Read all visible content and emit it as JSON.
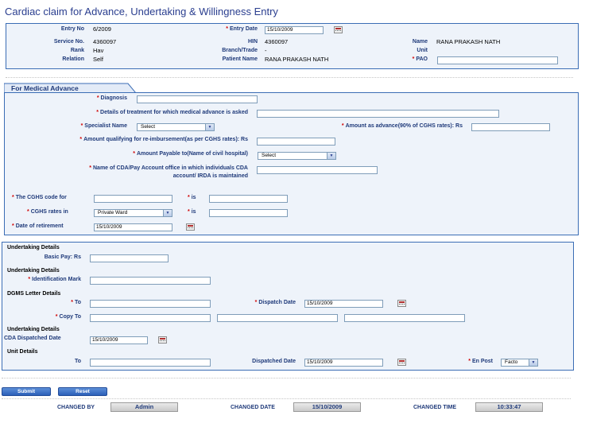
{
  "page": {
    "title": "Cardiac claim for Advance, Undertaking & Willingness Entry"
  },
  "header": {
    "entry_no_label": "Entry No",
    "entry_no": "6/2009",
    "entry_date_label": "Entry Date",
    "entry_date": "15/10/2009",
    "service_no_label": "Service No.",
    "service_no": "4360097",
    "hin_label": "HIN",
    "hin": "4360097",
    "name_label": "Name",
    "name": "RANA PRAKASH NATH",
    "rank_label": "Rank",
    "rank": "Hav",
    "branch_label": "Branch/Trade",
    "branch": "-",
    "unit_label": "Unit",
    "unit": "",
    "relation_label": "Relation",
    "relation": "Self",
    "patient_name_label": "Patient Name",
    "patient_name": "RANA PRAKASH NATH",
    "pao_label": "PAO",
    "pao": ""
  },
  "medical": {
    "section_title": "For Medical Advance",
    "diagnosis_label": "Diagnosis",
    "diagnosis": "",
    "details_label": "Details of treatment for which medical advance is asked",
    "details": "",
    "specialist_label": "Specialist Name",
    "specialist": "Select",
    "amount_advance_label": "Amount as advance(90% of CGHS rates): Rs",
    "amount_advance": "",
    "amount_reimb_label": "Amount qualifying for re-imbursement(as per CGHS rates): Rs",
    "amount_reimb": "",
    "payable_label": "Amount Payable to(Name of civil hospital)",
    "payable": "Select",
    "cda_label_1": "Name of CDA/Pay Account office in which individuals CDA",
    "cda_label_2": "account/ IRDA is maintained",
    "cda": "",
    "cghs_code_label": "The CGHS code for",
    "cghs_code": "",
    "is_label": "is",
    "cghs_code_is": "",
    "cghs_rates_label": "CGHS rates in",
    "cghs_rates": "Private Ward",
    "cghs_rates_is": "",
    "retirement_label": "Date of retirement",
    "retirement": "15/10/2009"
  },
  "undertaking": {
    "heading1": "Undertaking Details",
    "basic_pay_label": "Basic Pay: Rs",
    "basic_pay": "",
    "heading2": "Undertaking Details",
    "identification_label": "Identification Mark",
    "identification": "",
    "heading3": "DGMS Letter Details",
    "to_label": "To",
    "to": "",
    "dispatch_date_label": "Dispatch Date",
    "dispatch_date": "15/10/2009",
    "copy_to_label": "Copy To",
    "copy_to_1": "",
    "copy_to_2": "",
    "copy_to_3": "",
    "heading4": "Undertaking Details",
    "cda_dispatched_label": "CDA Dispatched Date",
    "cda_dispatched": "15/10/2009",
    "heading5": "Unit Details",
    "unit_to_label": "To",
    "unit_to": "",
    "dispatched_date_label": "Dispatched Date",
    "dispatched_date": "15/10/2009",
    "en_post_label": "En Post",
    "en_post": "Facto"
  },
  "actions": {
    "submit": "Submit",
    "reset": "Reset"
  },
  "footer": {
    "changed_by_label": "CHANGED BY",
    "changed_by": "Admin",
    "changed_date_label": "CHANGED DATE",
    "changed_date": "15/10/2009",
    "changed_time_label": "CHANGED TIME",
    "changed_time": "10:33:47"
  },
  "colors": {
    "accent": "#3b6db5",
    "title": "#2a3e8f",
    "label": "#1f3a7a",
    "required": "#d00000",
    "panel": "#eef3fa"
  },
  "icons": {
    "calendar": "calendar-icon",
    "dropdown": "chevron-down-icon"
  }
}
